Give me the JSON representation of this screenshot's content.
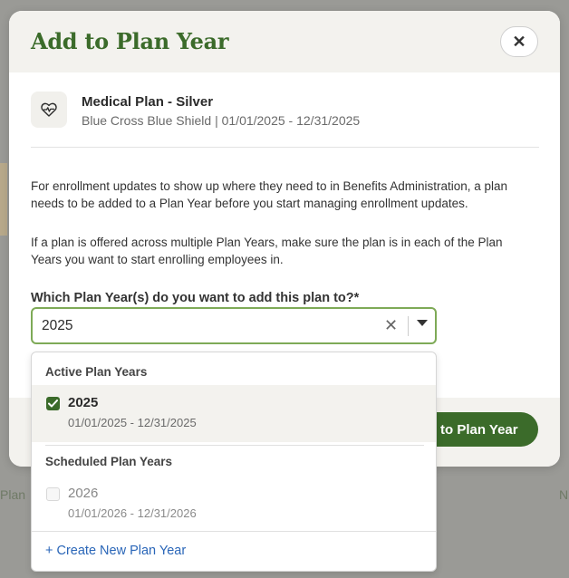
{
  "modal": {
    "title": "Add to Plan Year",
    "close_icon": "close-icon",
    "plan": {
      "icon": "heart-pulse-icon",
      "name": "Medical Plan - Silver",
      "subtitle": "Blue Cross Blue Shield | 01/01/2025 - 12/31/2025"
    },
    "paragraph_1": "For enrollment updates to show up where they need to in Benefits Administration, a plan needs to be added to a Plan Year before you start managing enrollment updates.",
    "paragraph_2": "If a plan is offered across multiple Plan Years, make sure the plan is in each of the Plan Years you want to start enrolling employees in.",
    "field_label": "Which Plan Year(s) do you want to add this plan to?*",
    "select_value": "2025",
    "primary_button": "to Plan Year"
  },
  "dropdown": {
    "active_header": "Active Plan Years",
    "active_option": {
      "name": "2025",
      "dates": "01/01/2025 - 12/31/2025",
      "checked": true
    },
    "scheduled_header": "Scheduled Plan Years",
    "scheduled_option": {
      "name": "2026",
      "dates": "01/01/2026 - 12/31/2026",
      "checked": false
    },
    "create_link": "+ Create New Plan Year"
  },
  "colors": {
    "brand_green": "#3b6b2a",
    "focus_border": "#7eaa57",
    "link_blue": "#2a66b8"
  }
}
